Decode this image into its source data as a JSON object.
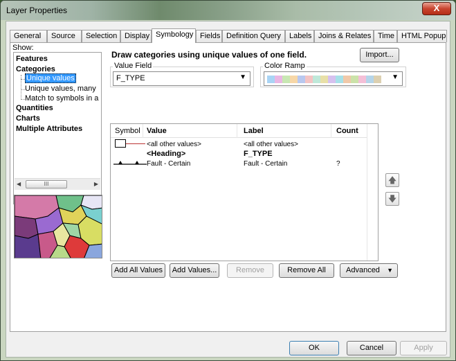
{
  "window": {
    "title": "Layer Properties",
    "close_label": "X"
  },
  "tabs": [
    {
      "label": "General"
    },
    {
      "label": "Source"
    },
    {
      "label": "Selection"
    },
    {
      "label": "Display"
    },
    {
      "label": "Symbology"
    },
    {
      "label": "Fields"
    },
    {
      "label": "Definition Query"
    },
    {
      "label": "Labels"
    },
    {
      "label": "Joins & Relates"
    },
    {
      "label": "Time"
    },
    {
      "label": "HTML Popup"
    }
  ],
  "active_tab": "Symbology",
  "show": {
    "label": "Show:",
    "items": [
      {
        "label": "Features"
      },
      {
        "label": "Categories"
      },
      {
        "label": "Unique values"
      },
      {
        "label": "Unique values, many"
      },
      {
        "label": "Match to symbols in a"
      },
      {
        "label": "Quantities"
      },
      {
        "label": "Charts"
      },
      {
        "label": "Multiple Attributes"
      }
    ],
    "scroll_thumb": "III"
  },
  "symbology": {
    "heading": "Draw categories using unique values of one field.",
    "import_label": "Import...",
    "value_field_label": "Value Field",
    "value_field_value": "F_TYPE",
    "color_ramp_label": "Color Ramp",
    "ramp_colors": [
      "#a9d4f5",
      "#e9b7e3",
      "#c8e7b3",
      "#f7d7a7",
      "#b9c8ef",
      "#f4c4c4",
      "#bfe8d9",
      "#e8e0a8",
      "#d6c1ef",
      "#a7e1e8",
      "#f0c9a9",
      "#cbe2a9",
      "#f4bfd7",
      "#b5d5e9",
      "#dcd0b1"
    ]
  },
  "grid": {
    "headers": {
      "symbol": "Symbol",
      "value": "Value",
      "label": "Label",
      "count": "Count"
    },
    "rows": [
      {
        "value": "<all other values>",
        "label": "<all other values>",
        "count": "",
        "bold": false
      },
      {
        "value": "<Heading>",
        "label": "F_TYPE",
        "count": "",
        "bold": true
      },
      {
        "value": "Fault - Certain",
        "label": "Fault - Certain",
        "count": "?",
        "bold": false
      }
    ]
  },
  "buttons": {
    "add_all": "Add All Values",
    "add_values": "Add Values...",
    "remove": "Remove",
    "remove_all": "Remove All",
    "advanced": "Advanced",
    "ok": "OK",
    "cancel": "Cancel",
    "apply": "Apply"
  }
}
